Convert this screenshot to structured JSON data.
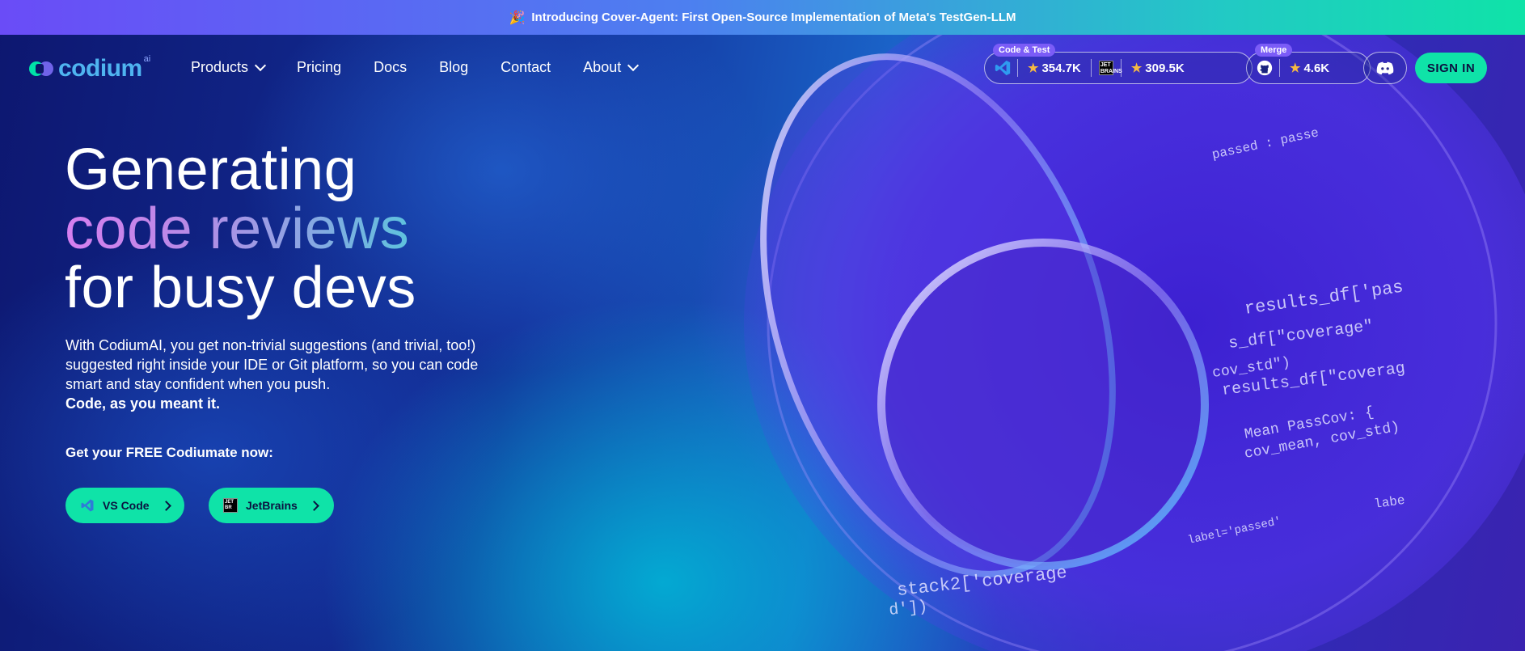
{
  "announcement": {
    "emoji": "🎉",
    "text": "Introducing Cover-Agent: First Open-Source Implementation of Meta's TestGen-LLM"
  },
  "logo": {
    "text": "codium",
    "suffix": "ai"
  },
  "nav": {
    "items": [
      {
        "label": "Products",
        "has_dropdown": true
      },
      {
        "label": "Pricing",
        "has_dropdown": false
      },
      {
        "label": "Docs",
        "has_dropdown": false
      },
      {
        "label": "Blog",
        "has_dropdown": false
      },
      {
        "label": "Contact",
        "has_dropdown": false
      },
      {
        "label": "About",
        "has_dropdown": true
      }
    ]
  },
  "stats": {
    "code_test": {
      "badge": "Code & Test",
      "vscode_count": "354.7K",
      "jetbrains_count": "309.5K"
    },
    "merge": {
      "badge": "Merge",
      "github_count": "4.6K"
    }
  },
  "sign_in": {
    "label": "SIGN IN"
  },
  "hero": {
    "title_line1": "Generating",
    "title_line2": "code reviews",
    "title_line3": "for busy devs",
    "description": "With CodiumAI, you get non-trivial suggestions (and trivial, too!) suggested right inside your IDE or Git platform, so you can code smart and stay confident when you push.",
    "tagline": "Code, as you meant it.",
    "cta_label": "Get your FREE Codiumate now:",
    "buttons": [
      {
        "label": "VS Code",
        "icon": "vscode-icon"
      },
      {
        "label": "JetBrains",
        "icon": "jetbrains-icon"
      }
    ]
  },
  "colors": {
    "accent": "#0fe3a8",
    "brand_purple": "#7b5cf7",
    "logo_blue": "#4fb4f0",
    "star": "#f5b942"
  },
  "visual": {
    "code_text": [
      "results_df['pas",
      "s_df[\"coverage\"",
      "cov_std\")",
      "results_df[\"coverag",
      "Mean PassCov: {",
      "cov_mean, cov_std)",
      "stack2['coverage",
      "d'])",
      "label='passed'",
      "passed : passe",
      "labe"
    ]
  }
}
